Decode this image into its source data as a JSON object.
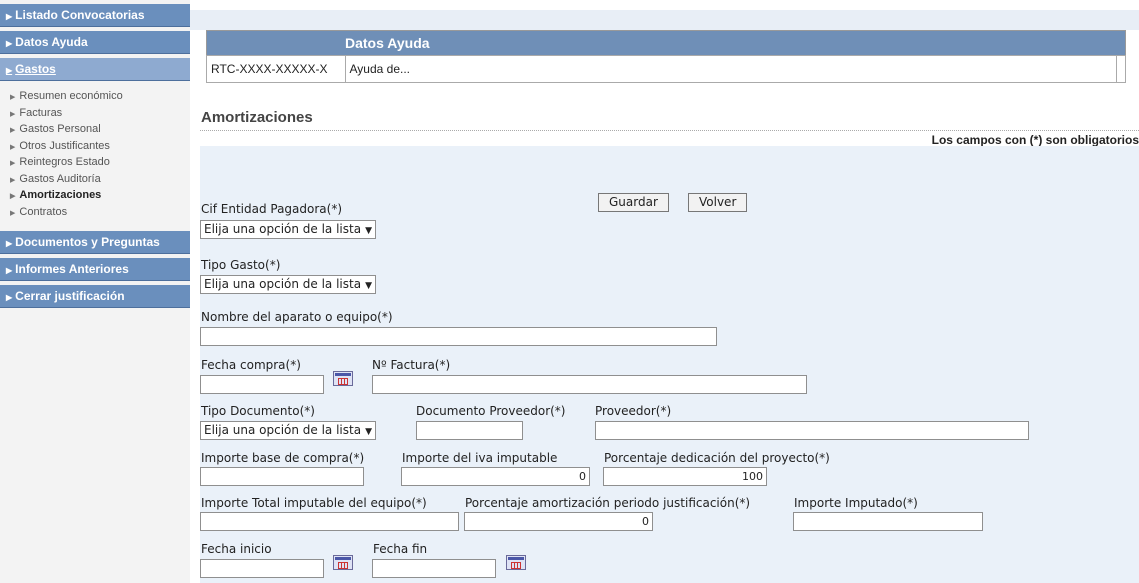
{
  "sidebar": {
    "sections": [
      {
        "label": "Listado Convocatorias"
      },
      {
        "label": "Datos Ayuda"
      },
      {
        "label": "Gastos"
      }
    ],
    "gastos_items": [
      {
        "label": "Resumen económico"
      },
      {
        "label": "Facturas"
      },
      {
        "label": "Gastos Personal"
      },
      {
        "label": "Otros Justificantes"
      },
      {
        "label": "Reintegros Estado"
      },
      {
        "label": "Gastos Auditoría"
      },
      {
        "label": "Amortizaciones"
      },
      {
        "label": "Contratos"
      }
    ],
    "sections_bottom": [
      {
        "label": "Documentos y Preguntas"
      },
      {
        "label": "Informes Anteriores"
      },
      {
        "label": "Cerrar justificación"
      }
    ]
  },
  "datos_ayuda": {
    "header": "Datos Ayuda",
    "code": "RTC-XXXX-XXXXX-X",
    "title": "Ayuda de..."
  },
  "page": {
    "section_title": "Amortizaciones",
    "required_note": "Los campos con (*) son obligatorios"
  },
  "buttons": {
    "save": "Guardar",
    "back": "Volver"
  },
  "form": {
    "cif_label": "Cif Entidad Pagadora(*)",
    "cif_value": "Elija una opción de la lista",
    "tipo_gasto_label": "Tipo Gasto(*)",
    "tipo_gasto_value": "Elija una opción de la lista",
    "nombre_label": "Nombre del aparato o equipo(*)",
    "nombre_value": "",
    "fecha_compra_label": "Fecha compra(*)",
    "fecha_compra_value": "",
    "num_factura_label": "Nº Factura(*)",
    "num_factura_value": "",
    "tipo_doc_label": "Tipo Documento(*)",
    "tipo_doc_value": "Elija una opción de la lista",
    "doc_proveedor_label": "Documento Proveedor(*)",
    "doc_proveedor_value": "",
    "proveedor_label": "Proveedor(*)",
    "proveedor_value": "",
    "importe_base_label": "Importe base de compra(*)",
    "importe_base_value": "",
    "importe_iva_label": "Importe del iva imputable",
    "importe_iva_value": "0",
    "porcentaje_dedicacion_label": "Porcentaje dedicación del proyecto(*)",
    "porcentaje_dedicacion_value": "100",
    "importe_total_label": "Importe Total imputable del equipo(*)",
    "importe_total_value": "",
    "porcentaje_amort_label": "Porcentaje amortización periodo justificación(*)",
    "porcentaje_amort_value": "0",
    "importe_imputado_label": "Importe Imputado(*)",
    "importe_imputado_value": "",
    "fecha_inicio_label": "Fecha inicio",
    "fecha_inicio_value": "",
    "fecha_fin_label": "Fecha fin",
    "fecha_fin_value": ""
  },
  "icons": {
    "calendar": "calendar-icon",
    "arrow": "triangle-right-icon",
    "dropdown": "chevron-down-icon"
  },
  "colors": {
    "sidebar_header": "#6a8fbd",
    "table_header": "#6f8fb7",
    "form_background": "#eaf1f9"
  }
}
